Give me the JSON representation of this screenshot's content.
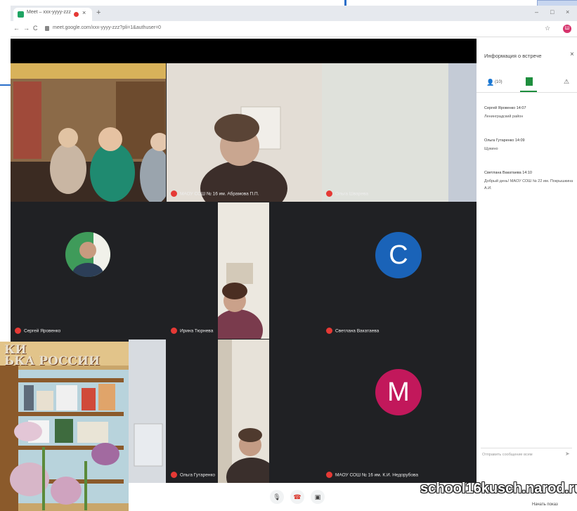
{
  "browser": {
    "tab_title": "Meet – xxx-yyyy-zzz",
    "tab_close": "×",
    "new_tab": "+",
    "nav_back": "←",
    "nav_forward": "→",
    "nav_reload": "C",
    "url": "meet.google.com/xxx-yyyy-zzz?pli=1&authuser=0",
    "profile_letter": "Ш",
    "win_min": "–",
    "win_max": "□",
    "win_close": "×",
    "menu": "⋮"
  },
  "meet": {
    "tiles": [
      {
        "name": ""
      },
      {
        "name": "МАОУ СОШ № 16 им. Абрамова П.П."
      },
      {
        "name": "Ольга Шварева"
      },
      {
        "name": "Сергей Яровенко"
      },
      {
        "name": "Ирина Тюрнева"
      },
      {
        "name": "Светлана Вакатаева"
      },
      {
        "name": ""
      },
      {
        "name": "Ольга Гутаренко"
      },
      {
        "name": "МАОУ СОШ № 16 им. К.И. Недорубова"
      }
    ],
    "avatar_c": {
      "letter": "C",
      "color": "#1a63b8"
    },
    "avatar_m": {
      "letter": "M",
      "color": "#c2185b"
    }
  },
  "panel": {
    "title": "Информация о встрече",
    "close": "×",
    "people_count": "(10)",
    "messages": [
      {
        "name": "Сергей Яровенко  14:07",
        "text": "Ленинградский район"
      },
      {
        "name": "Ольга Гутаренко  14:09",
        "text": "Щукино"
      },
      {
        "name": "Светлана Вакатаева  14:10",
        "text": "Добрый день! МАОУ СОШ № 22 им. Покрышкина",
        "text2": "А.И."
      }
    ],
    "input_placeholder": "Отправить сообщение всем"
  },
  "bottom": {
    "present_label": "Начать показ",
    "mic_icon": "🎙",
    "hangup_icon": "☎",
    "cam_icon": "▣"
  },
  "overlay": {
    "book_sign": "КИ\nЬКА РОССИИ",
    "watermark": "school16kusch.narod.ru"
  }
}
